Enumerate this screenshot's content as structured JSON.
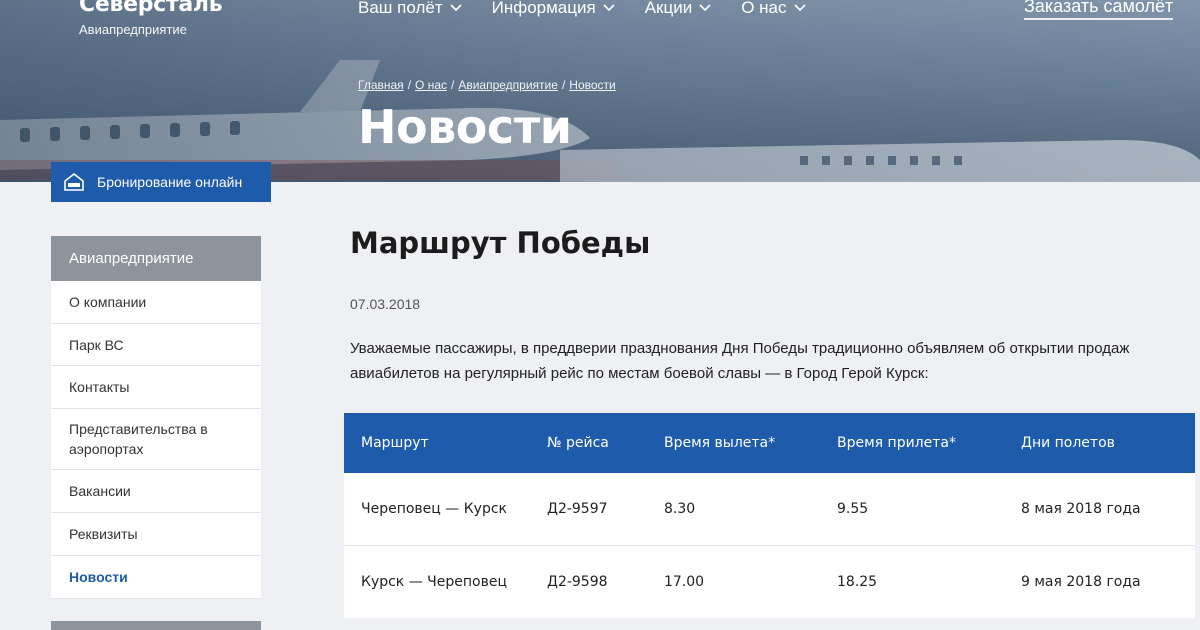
{
  "logo": {
    "name": "Северсталь",
    "subtitle": "Авиапредприятие"
  },
  "topnav": [
    {
      "label": "Ваш полёт"
    },
    {
      "label": "Информация"
    },
    {
      "label": "Акции"
    },
    {
      "label": "О нас"
    }
  ],
  "order_plane": "Заказать самолёт",
  "breadcrumb": [
    "Главная",
    "О нас",
    "Авиапредприятие",
    "Новости"
  ],
  "hero_title": "Новости",
  "booking_button": "Бронирование онлайн",
  "sidebar": {
    "heading": "Авиапредприятие",
    "items": [
      {
        "label": "О компании",
        "active": false
      },
      {
        "label": "Парк ВС",
        "active": false
      },
      {
        "label": "Контакты",
        "active": false
      },
      {
        "label": "Представительства в аэропортах",
        "active": false
      },
      {
        "label": "Вакансии",
        "active": false
      },
      {
        "label": "Реквизиты",
        "active": false
      },
      {
        "label": "Новости",
        "active": true
      }
    ]
  },
  "article": {
    "title": "Маршрут Победы",
    "date": "07.03.2018",
    "intro": "Уважаемые пассажиры, в преддверии празднования Дня Победы традиционно объявляем об открытии продаж авиабилетов на регулярный рейс по местам боевой славы — в Город Герой Курск:"
  },
  "schedule": {
    "headers": [
      "Маршрут",
      "№ рейса",
      "Время вылета*",
      "Время прилета*",
      "Дни полетов"
    ],
    "rows": [
      [
        "Череповец — Курск",
        "Д2-9597",
        "8.30",
        "9.55",
        "8 мая 2018 года"
      ],
      [
        "Курск — Череповец",
        "Д2-9598",
        "17.00",
        "18.25",
        "9 мая 2018 года"
      ]
    ]
  },
  "colors": {
    "primary": "#1e5bab",
    "sidebar_head": "#8d949c",
    "page_bg": "#eef0f3"
  }
}
